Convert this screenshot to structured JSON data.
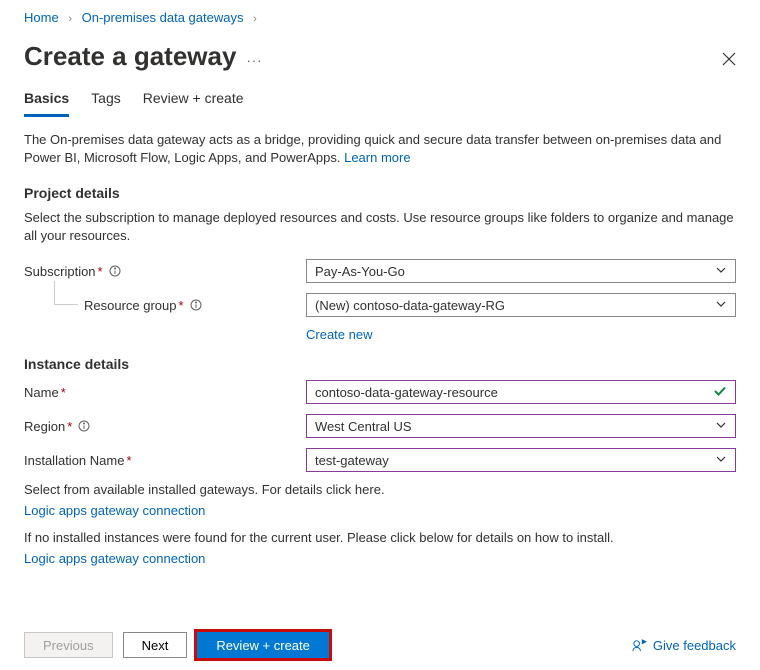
{
  "breadcrumb": {
    "home": "Home",
    "gateways": "On-premises data gateways"
  },
  "title": "Create a gateway",
  "tabs": {
    "basics": "Basics",
    "tags": "Tags",
    "review": "Review + create"
  },
  "intro": {
    "text": "The On-premises data gateway acts as a bridge, providing quick and secure data transfer between on-premises data and Power BI, Microsoft Flow, Logic Apps, and PowerApps. ",
    "learn_more": "Learn more"
  },
  "project": {
    "heading": "Project details",
    "desc": "Select the subscription to manage deployed resources and costs. Use resource groups like folders to organize and manage all your resources.",
    "subscription_label": "Subscription",
    "subscription_value": "Pay-As-You-Go",
    "rg_label": "Resource group",
    "rg_value": "(New) contoso-data-gateway-RG",
    "create_new": "Create new"
  },
  "instance": {
    "heading": "Instance details",
    "name_label": "Name",
    "name_value": "contoso-data-gateway-resource",
    "region_label": "Region",
    "region_value": "West Central US",
    "install_label": "Installation Name",
    "install_value": "test-gateway",
    "help1": "Select from available installed gateways. For details click here.",
    "link1": "Logic apps gateway connection",
    "help2": "If no installed instances were found for the current user. Please click below for details on how to install.",
    "link2": "Logic apps gateway connection"
  },
  "footer": {
    "previous": "Previous",
    "next": "Next",
    "review": "Review + create",
    "feedback": "Give feedback"
  }
}
